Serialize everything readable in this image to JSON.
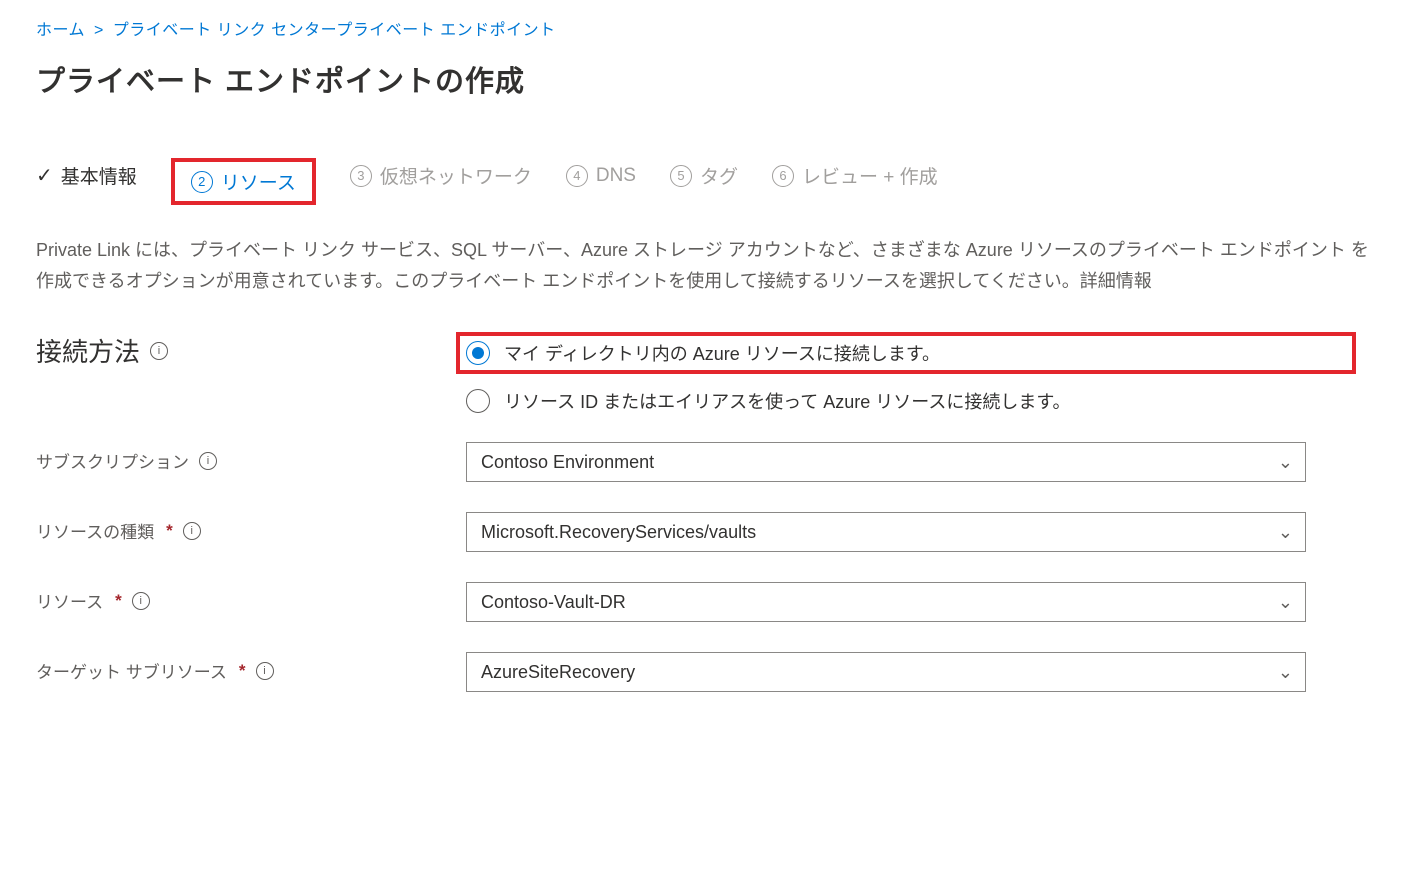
{
  "breadcrumb": {
    "home": "ホーム",
    "sep": ">",
    "link": "プライベート リンク センタープライベート エンドポイント"
  },
  "page_title": "プライベート エンドポイントの作成",
  "tabs": {
    "t1": {
      "label": "基本情報"
    },
    "t2": {
      "num": "2",
      "label": "リソース"
    },
    "t3": {
      "num": "3",
      "label": "仮想ネットワーク"
    },
    "t4": {
      "num": "4",
      "label": "DNS"
    },
    "t5": {
      "num": "5",
      "label": "タグ"
    },
    "t6": {
      "num": "6",
      "label": "レビュー +  作成"
    }
  },
  "description": "Private  Link には、プライベート リンク サービス、SQL サーバー、Azure ストレージ アカウントなど、さまざまな Azure リソースのプライベート エンドポイント を作成できるオプションが用意されています。このプライベート エンドポイントを使用して接続するリソースを選択してください。詳細情報",
  "form": {
    "connection_method": {
      "label": "接続方法",
      "opt1": "マイ ディレクトリ内の Azure リソースに接続します。",
      "opt2": "リソース ID またはエイリアスを使って Azure リソースに接続します。"
    },
    "subscription": {
      "label": "サブスクリプション",
      "value": "Contoso Environment"
    },
    "resource_type": {
      "label": "リソースの種類",
      "required": "*",
      "value": "Microsoft.RecoveryServices/vaults"
    },
    "resource": {
      "label": "リソース",
      "required": "*",
      "value": "Contoso-Vault-DR"
    },
    "target_subresource": {
      "label": "ターゲット サブリソース",
      "required": "*",
      "value": "AzureSiteRecovery"
    }
  }
}
